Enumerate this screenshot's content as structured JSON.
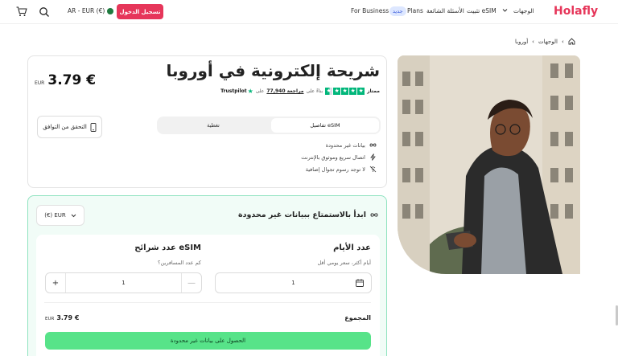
{
  "header": {
    "logo": "Holafly",
    "nav": {
      "destinations": "الوجهات",
      "install": "تثبيت eSIM",
      "faq": "الأسئلة الشائعة",
      "plans": "Plans",
      "plans_badge": "جديد",
      "business": "For Business"
    },
    "login_button": "تسجيل الدخول",
    "language_currency": "AR - EUR (€)"
  },
  "breadcrumb": {
    "items": [
      "الوجهات",
      "أوروبا"
    ]
  },
  "product": {
    "title": "شريحة إلكترونية في أوروبا",
    "price": "3.79 €",
    "currency_code": "EUR",
    "rating": {
      "label": "ممتاز",
      "stars": 4.5,
      "text_prefix": "بناءً على",
      "reviews_count": "77,940 مراجعة",
      "text_suffix": "على",
      "provider": "Trustpilot"
    },
    "compatibility_button": "التحقق من التوافق",
    "tabs": [
      "تفاصيل eSIM",
      "تغطية"
    ],
    "active_tab": 0,
    "features": [
      "بيانات غير محدودة",
      "اتصال سريع وموثوق بالإنترنت",
      "لا توجد رسوم تجوال إضافية"
    ]
  },
  "plan": {
    "heading": "ابدأ بالاستمتاع ببيانات غير محدودة",
    "currency_select": "(€) EUR",
    "days": {
      "label": "عدد الأيام",
      "sub": "أيام أكثر، سعر يومي أقل",
      "value": "1"
    },
    "esims": {
      "label": "عدد شرائح eSIM",
      "sub": "كم عدد المسافرين؟",
      "value": "1",
      "minus": "—",
      "plus": "+"
    },
    "total_label": "المجموع",
    "total_value": "3.79 €",
    "total_currency": "EUR",
    "cta": "الحصول على بيانات غير محدودة"
  },
  "colors": {
    "brand": "#e6365a",
    "cta": "#57e389",
    "trustpilot": "#00b67a",
    "plan_border": "#8fe3c0"
  }
}
